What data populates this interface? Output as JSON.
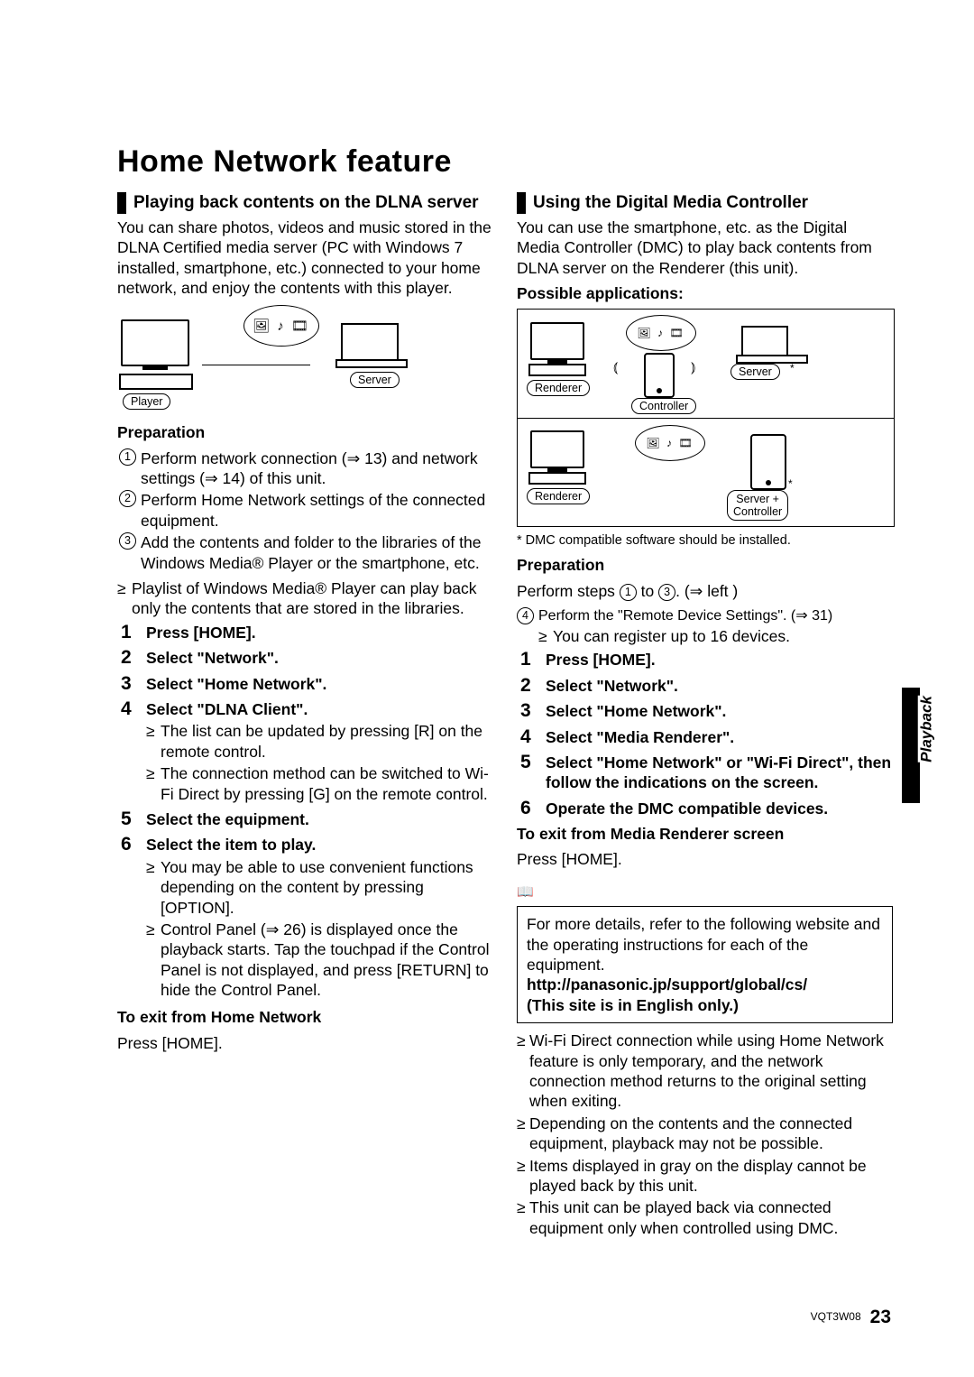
{
  "title": "Home Network feature",
  "footer_doc": "VQT3W08",
  "footer_page": "23",
  "side_tab": "Playback",
  "left": {
    "section_title": "Playing back contents on the DLNA server",
    "intro": "You can share photos, videos and music stored in the DLNA Certified media server (PC with Windows 7 installed, smartphone, etc.) connected to your home network, and enjoy the contents with this player.",
    "diagram": {
      "player": "Player",
      "server": "Server"
    },
    "prep_heading": "Preparation",
    "prep": [
      "Perform network connection (⇒ 13) and network settings (⇒ 14) of this unit.",
      "Perform Home Network settings of the connected equipment.",
      "Add the contents and folder to the libraries of the Windows Media® Player or the smartphone, etc."
    ],
    "prep_note": "Playlist of Windows Media® Player can play back only the contents that are stored in the libraries.",
    "steps": [
      {
        "t": "Press [HOME]."
      },
      {
        "t": "Select \"Network\"."
      },
      {
        "t": "Select \"Home Network\"."
      },
      {
        "t": "Select \"DLNA Client\".",
        "bullets": [
          "The list can be updated by pressing [R] on the remote control.",
          "The connection method can be switched to Wi-Fi Direct by pressing [G] on the remote control."
        ]
      },
      {
        "t": "Select the equipment."
      },
      {
        "t": "Select the item to play.",
        "bullets": [
          "You may be able to use convenient functions depending on the content by pressing [OPTION].",
          "Control Panel (⇒ 26) is displayed once the playback starts. Tap the touchpad if the Control Panel is not displayed, and press [RETURN] to hide the Control Panel."
        ]
      }
    ],
    "exit_h": "To exit from Home Network",
    "exit_t": "Press [HOME]."
  },
  "right": {
    "section_title": "Using the Digital Media Controller",
    "intro": "You can use the smartphone, etc. as the Digital Media Controller (DMC) to play back contents from DLNA server on the Renderer (this unit).",
    "apps_h": "Possible applications:",
    "diagram": {
      "renderer": "Renderer",
      "server": "Server",
      "controller": "Controller",
      "servercontroller": "Server +\nController"
    },
    "diag_foot": "* DMC compatible software should be installed.",
    "prep_heading": "Preparation",
    "prep_intro_a": "Perform steps ",
    "prep_intro_b": " to ",
    "prep_intro_c": ". (⇒ left )",
    "prep4": "Perform the \"Remote Device Settings\". (⇒ 31)",
    "prep4_b": "You can register up to 16 devices.",
    "steps": [
      {
        "t": "Press [HOME]."
      },
      {
        "t": "Select \"Network\"."
      },
      {
        "t": "Select \"Home Network\"."
      },
      {
        "t": "Select \"Media Renderer\"."
      },
      {
        "t": "Select \"Home Network\" or \"Wi-Fi Direct\", then follow the indications on the screen."
      },
      {
        "t": "Operate the DMC compatible devices."
      }
    ],
    "exit_h": "To exit from Media Renderer screen",
    "exit_t": "Press [HOME].",
    "notebox_a": "For more details, refer to the following website and the operating instructions for each of the equipment.",
    "notebox_b": "http://panasonic.jp/support/global/cs/",
    "notebox_c": "(This site is in English only.)",
    "notes": [
      "Wi-Fi Direct connection while using Home Network feature is only temporary, and the network connection method returns to the original setting when exiting.",
      "Depending on the contents and the connected equipment, playback may not be possible.",
      "Items displayed in gray on the display cannot be played back by this unit.",
      "This unit can be played back via connected equipment only when controlled using DMC."
    ]
  }
}
